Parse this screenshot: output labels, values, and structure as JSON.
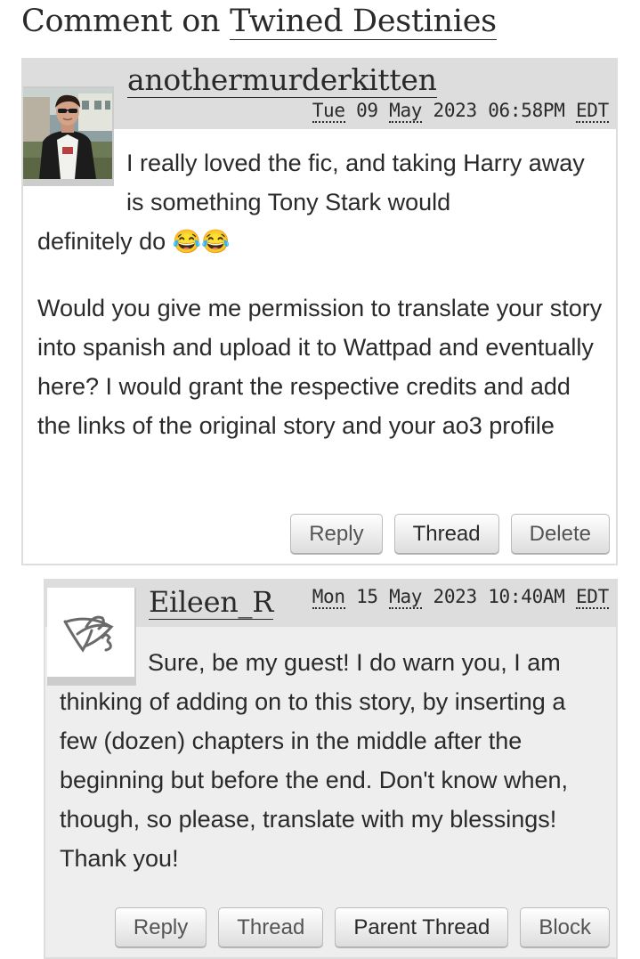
{
  "page": {
    "title_prefix": "Comment on ",
    "work_title": "Twined Destinies"
  },
  "comments": [
    {
      "author": "anothermurderkitten",
      "date": {
        "weekday": "Tue",
        "day": "09",
        "month": "May",
        "year": "2023",
        "time": "06:58PM",
        "tz": "EDT"
      },
      "paragraph1_lead": "I really loved the fic, and taking Harry away is something Tony Stark would",
      "paragraph1_tail": "definitely do",
      "paragraph1_emoji": "😂😂",
      "paragraph2": "Would you give me permission to translate your story into spanish and upload it to Wattpad and eventually here? I would grant the respective credits and add the links of the original story and your ao3 profile",
      "actions": {
        "reply": "Reply",
        "thread": "Thread",
        "delete": "Delete"
      }
    },
    {
      "author": "Eileen_R",
      "date": {
        "weekday": "Mon",
        "day": "15",
        "month": "May",
        "year": "2023",
        "time": "10:40AM",
        "tz": "EDT"
      },
      "paragraph1": "Sure, be my guest! I do warn you, I am thinking of adding on to this story, by inserting a few (dozen) chapters in the middle after the beginning but before the end. Don't know when, though, so please, translate with my blessings! Thank you!",
      "actions": {
        "reply": "Reply",
        "thread": "Thread",
        "parent_thread": "Parent Thread",
        "block": "Block"
      }
    }
  ]
}
